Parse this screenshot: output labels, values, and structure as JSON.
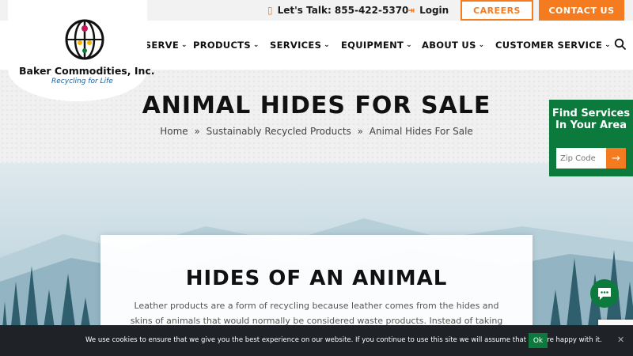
{
  "topbar": {
    "talk_label": "Let's Talk: 855-422-5370",
    "login_label": "Login",
    "careers_label": "CAREERS",
    "contact_label": "CONTACT US"
  },
  "logo": {
    "name": "Baker Commodities, Inc.",
    "tagline": "Recycling for Life"
  },
  "nav": {
    "items": [
      "WHO WE SERVE",
      "PRODUCTS",
      "SERVICES",
      "EQUIPMENT",
      "ABOUT US",
      "CUSTOMER SERVICE"
    ]
  },
  "hero": {
    "title": "ANIMAL HIDES FOR SALE",
    "breadcrumb": [
      "Home",
      "Sustainably Recycled Products",
      "Animal Hides For Sale"
    ],
    "separator": "»"
  },
  "find_services": {
    "title": "Find Services In Your Area",
    "zip_placeholder": "Zip Code"
  },
  "content": {
    "title": "HIDES OF AN ANIMAL",
    "text": "Leather products are a form of recycling because leather comes from the hides and skins of animals that would normally be considered waste products. Instead of taking up space in a"
  },
  "cookie": {
    "text": "We use cookies to ensure that we give you the best experience on our website. If you continue to use this site we will assume that you are happy with it.",
    "ok_label": "Ok",
    "close_label": "✕"
  },
  "colors": {
    "accent": "#f47b20",
    "brand_green": "#0b7a3c",
    "cookie_bg": "#1f2226"
  }
}
